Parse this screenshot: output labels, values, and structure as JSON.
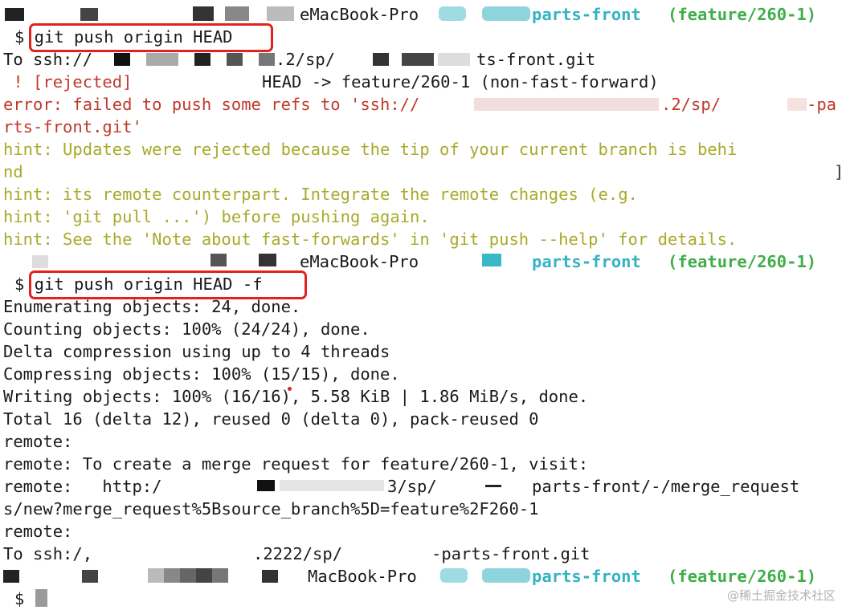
{
  "terminal": {
    "prompt_1": {
      "host": "eMacBook-Pro",
      "repo": "parts-front",
      "branch": "(feature/260-1)"
    },
    "cmd_1": "$ git push origin HEAD",
    "push1_to": "To ssh://",
    "push1_to_path": ".2/sp/",
    "push1_to_repo": "ts-front.git",
    "rejected_tag": " ! [rejected]",
    "rejected_detail": "HEAD -> feature/260-1 (non-fast-forward)",
    "error_line_1a": "error: failed to push some refs to 'ssh://",
    "error_line_1b": ".2/sp/",
    "error_line_1c": "-pa",
    "error_line_2": "rts-front.git'",
    "hint_1": "hint: Updates were rejected because the tip of your current branch is behi",
    "hint_1b": "nd",
    "hint_2": "hint: its remote counterpart. Integrate the remote changes (e.g.",
    "hint_3": "hint: 'git pull ...') before pushing again.",
    "hint_4": "hint: See the 'Note about fast-forwards' in 'git push --help' for details.",
    "prompt_2": {
      "host": "eMacBook-Pro",
      "repo": "parts-front",
      "branch": "(feature/260-1)"
    },
    "cmd_2": "$ git push origin HEAD -f",
    "out_1": "Enumerating objects: 24, done.",
    "out_2": "Counting objects: 100% (24/24), done.",
    "out_3": "Delta compression using up to 4 threads",
    "out_4": "Compressing objects: 100% (15/15), done.",
    "out_5": "Writing objects: 100% (16/16), 5.58 KiB | 1.86 MiB/s, done.",
    "out_6": "Total 16 (delta 12), reused 0 (delta 0), pack-reused 0",
    "out_7": "remote:",
    "out_8": "remote: To create a merge request for feature/260-1, visit:",
    "out_9a": "remote:   http:/",
    "out_9b": "3/sp/",
    "out_9c": "parts-front/-/merge_request",
    "out_10": "s/new?merge_request%5Bsource_branch%5D=feature%2F260-1",
    "out_11": "remote:",
    "out_12a": "To ssh:/,",
    "out_12b": ".2222/sp/",
    "out_12c": "-parts-front.git",
    "prompt_3": {
      "host": "MacBook-Pro",
      "repo": "parts-front",
      "branch": "(feature/260-1)"
    },
    "cmd_3": "$"
  },
  "watermark": "@稀土掘金技术社区",
  "colors": {
    "error": "#c0392b",
    "hint": "#a8aa2a",
    "repo": "#33b3c4",
    "branch": "#3fae49",
    "highlight_box": "#e2221c"
  }
}
